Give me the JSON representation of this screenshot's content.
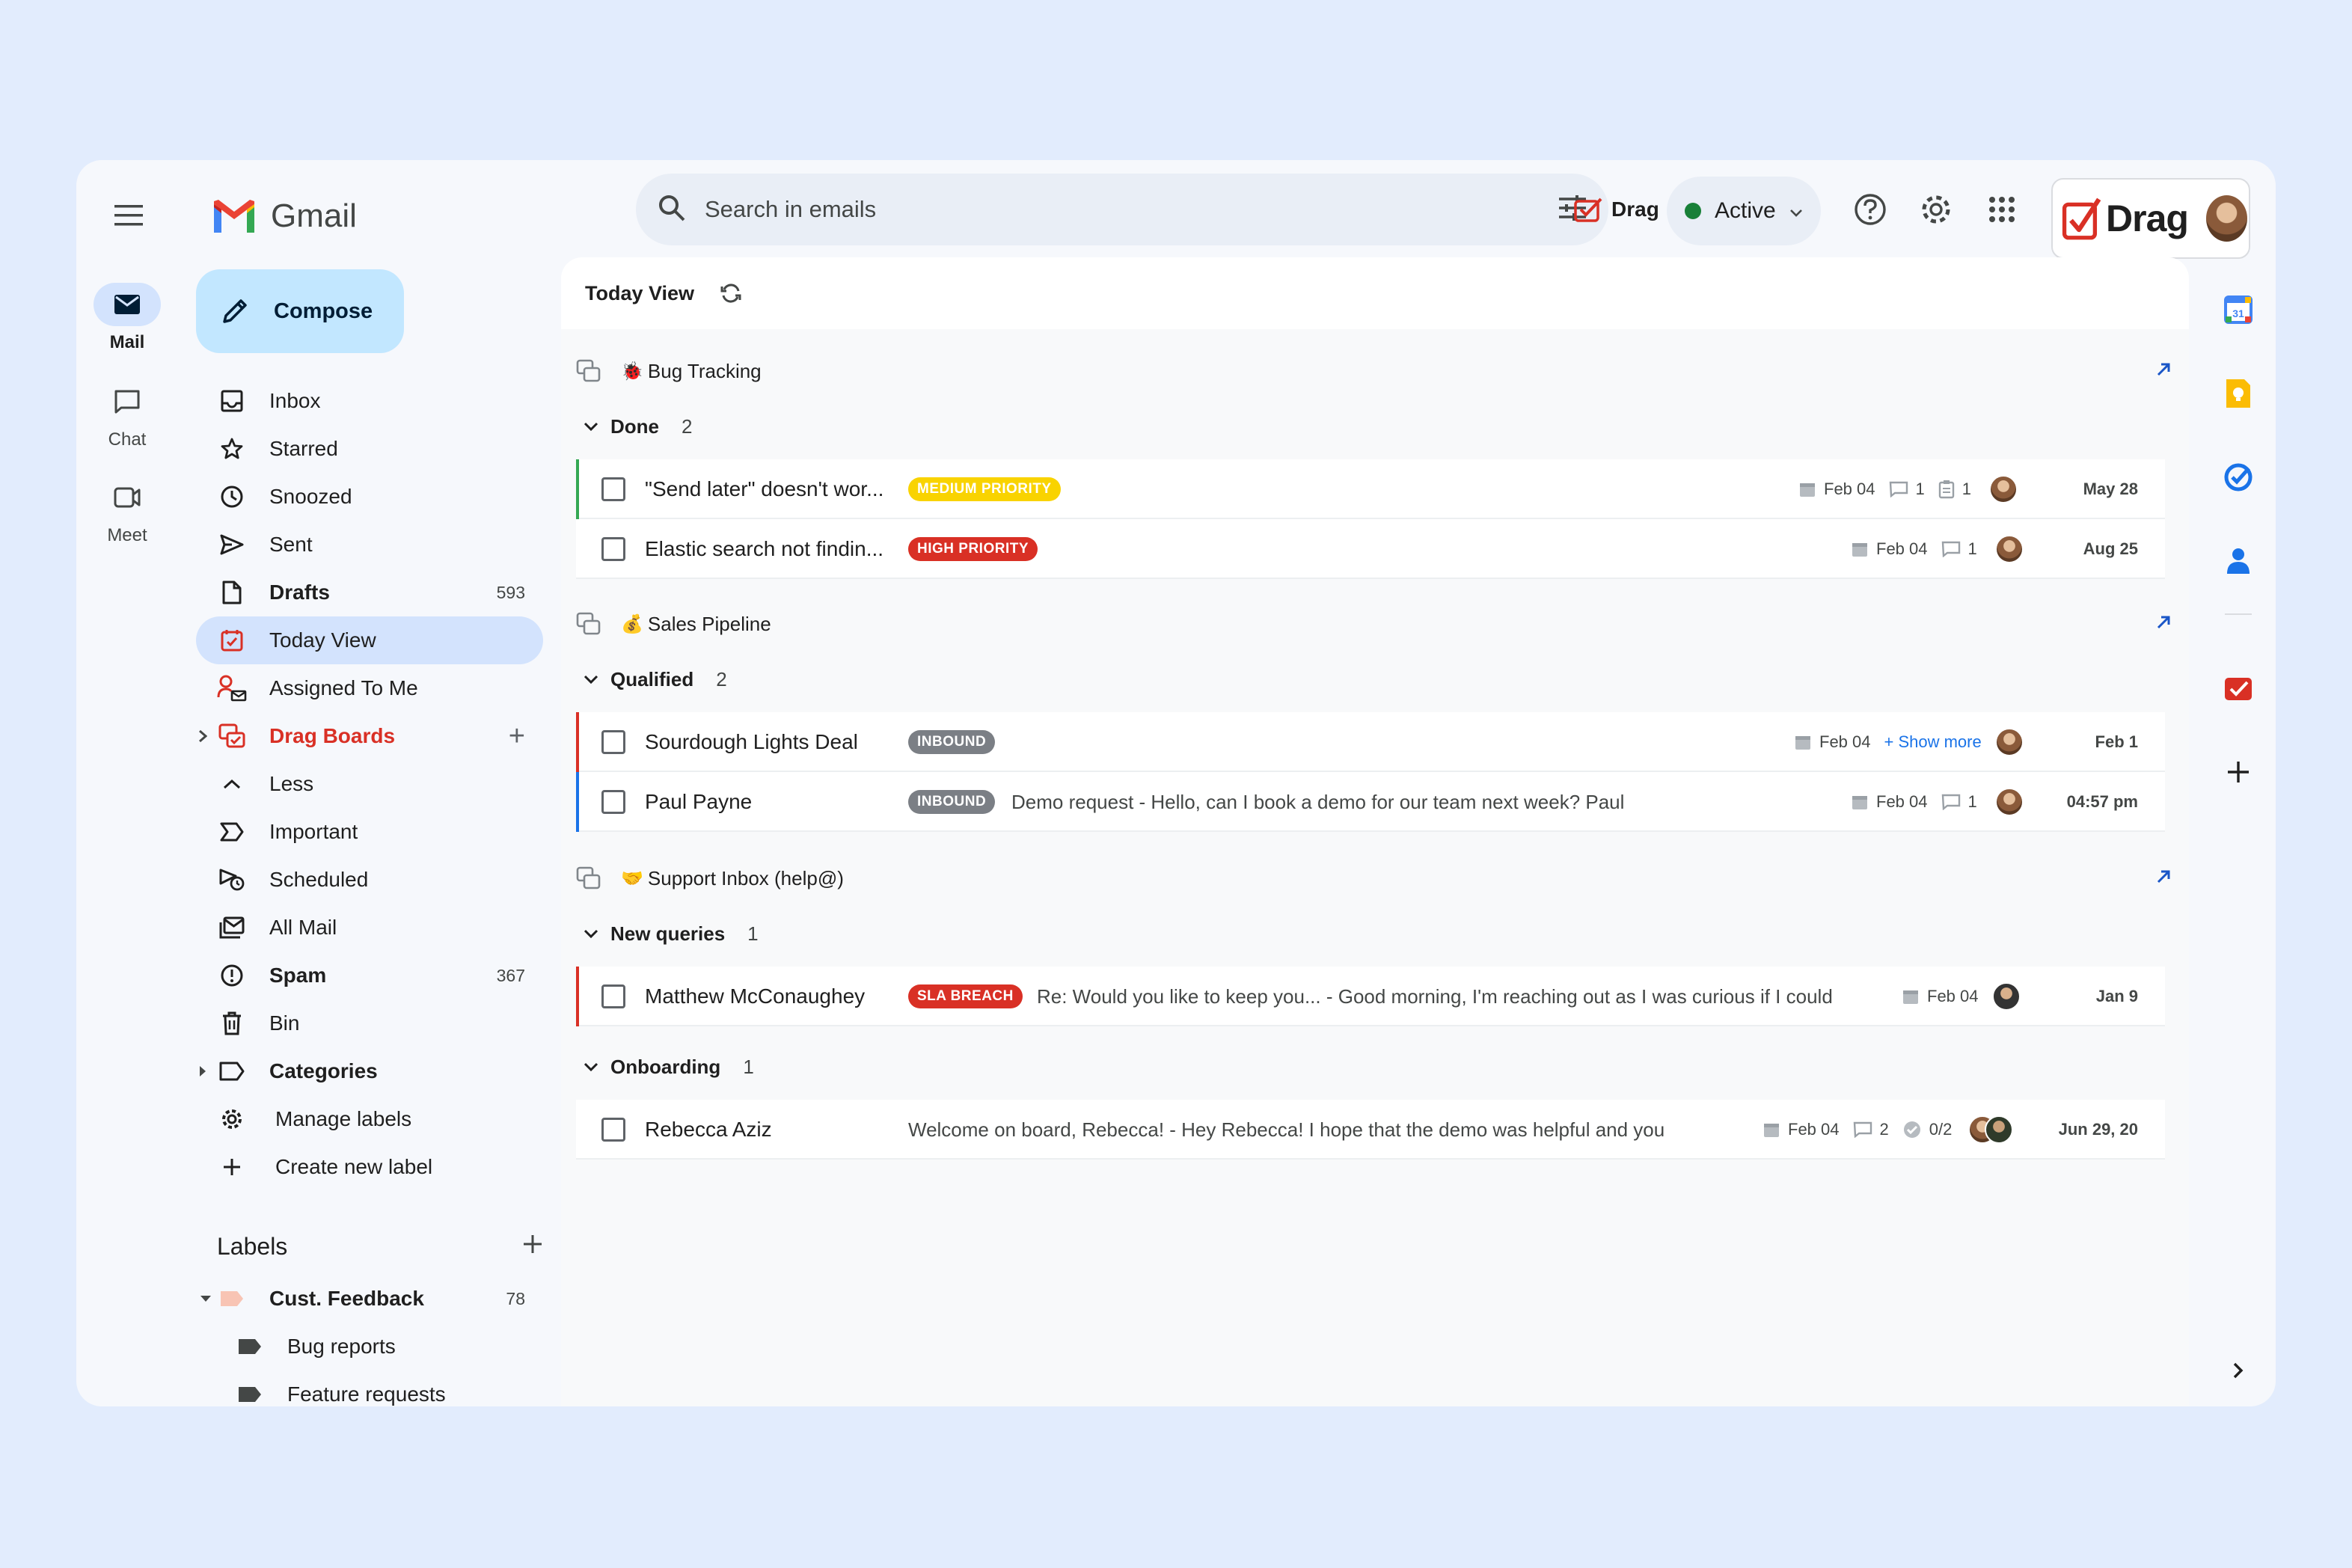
{
  "rail": {
    "items": [
      {
        "label": "Mail",
        "icon": "mail-icon"
      },
      {
        "label": "Chat",
        "icon": "chat-icon"
      },
      {
        "label": "Meet",
        "icon": "meet-icon"
      }
    ]
  },
  "app": {
    "name": "Gmail"
  },
  "compose": {
    "label": "Compose"
  },
  "nav": {
    "items": [
      {
        "label": "Inbox",
        "count": ""
      },
      {
        "label": "Starred",
        "count": ""
      },
      {
        "label": "Snoozed",
        "count": ""
      },
      {
        "label": "Sent",
        "count": ""
      },
      {
        "label": "Drafts",
        "count": "593"
      },
      {
        "label": "Today View",
        "count": ""
      },
      {
        "label": "Assigned To Me",
        "count": ""
      },
      {
        "label": "Drag Boards",
        "count": ""
      },
      {
        "label": "Less",
        "count": ""
      },
      {
        "label": "Important",
        "count": ""
      },
      {
        "label": "Scheduled",
        "count": ""
      },
      {
        "label": "All Mail",
        "count": ""
      },
      {
        "label": "Spam",
        "count": "367"
      },
      {
        "label": "Bin",
        "count": ""
      },
      {
        "label": "Categories",
        "count": ""
      },
      {
        "label": "Manage labels",
        "count": ""
      },
      {
        "label": "Create new label",
        "count": ""
      }
    ]
  },
  "labels": {
    "title": "Labels",
    "items": [
      {
        "label": "Cust. Feedback",
        "count": "78"
      },
      {
        "label": "Bug reports",
        "count": ""
      },
      {
        "label": "Feature requests",
        "count": ""
      }
    ]
  },
  "search": {
    "placeholder": "Search in emails"
  },
  "header": {
    "drag_label": "Drag",
    "status": "Active",
    "brand": "Drag"
  },
  "main": {
    "title": "Today View",
    "boards": [
      {
        "name": "Bug Tracking",
        "emoji": "🐞",
        "groups": [
          {
            "name": "Done",
            "count": "2",
            "rows": [
              {
                "title": "\"Send later\" doesn't wor...",
                "tag": "MEDIUM PRIORITY",
                "snippet": "",
                "due": "Feb 04",
                "comments": "1",
                "tasks": "1",
                "date": "May 28",
                "accent": "#34a853",
                "tag_color": "#f9d300"
              },
              {
                "title": "Elastic search not findin...",
                "tag": "HIGH PRIORITY",
                "snippet": "",
                "due": "Feb 04",
                "comments": "1",
                "tasks": "",
                "date": "Aug 25",
                "accent": "",
                "tag_color": "#d93025"
              }
            ]
          }
        ]
      },
      {
        "name": "Sales Pipeline",
        "emoji": "💰",
        "groups": [
          {
            "name": "Qualified",
            "count": "2",
            "rows": [
              {
                "title": "Sourdough Lights Deal",
                "tag": "INBOUND",
                "snippet": "",
                "due": "Feb 04",
                "show_more": "+ Show more",
                "date": "Feb 1",
                "accent": "#d93025",
                "tag_color": "#7b7f85"
              },
              {
                "title": "Paul Payne",
                "tag": "INBOUND",
                "snippet": "Demo request - Hello, can I book a demo for our team next week? Paul",
                "due": "Feb 04",
                "comments": "1",
                "date": "04:57 pm",
                "accent": "#1a73e8",
                "tag_color": "#7b7f85"
              }
            ]
          }
        ]
      },
      {
        "name": "Support Inbox (help@)",
        "emoji": "🤝",
        "groups": [
          {
            "name": "New queries",
            "count": "1",
            "rows": [
              {
                "title": "Matthew McConaughey",
                "tag": "SLA BREACH",
                "snippet": "Re: Would you like to keep you... - Good morning, I'm reaching out as I was curious if I could",
                "due": "Feb 04",
                "date": "Jan 9",
                "accent": "#d93025",
                "tag_color": "#d93025"
              }
            ]
          },
          {
            "name": "Onboarding",
            "count": "1",
            "rows": [
              {
                "title": "Rebecca Aziz",
                "tag": "",
                "snippet": "Welcome on board, Rebecca! - Hey Rebecca! I hope that the demo was helpful and you",
                "due": "Feb 04",
                "comments": "2",
                "checklist": "0/2",
                "date": "Jun 29, 20",
                "accent": "",
                "tag_color": ""
              }
            ]
          }
        ]
      }
    ]
  },
  "colors": {
    "accent_blue": "#d3e3fd",
    "compose": "#c2e7ff",
    "drag_red": "#d93025",
    "active_green": "#188038"
  }
}
